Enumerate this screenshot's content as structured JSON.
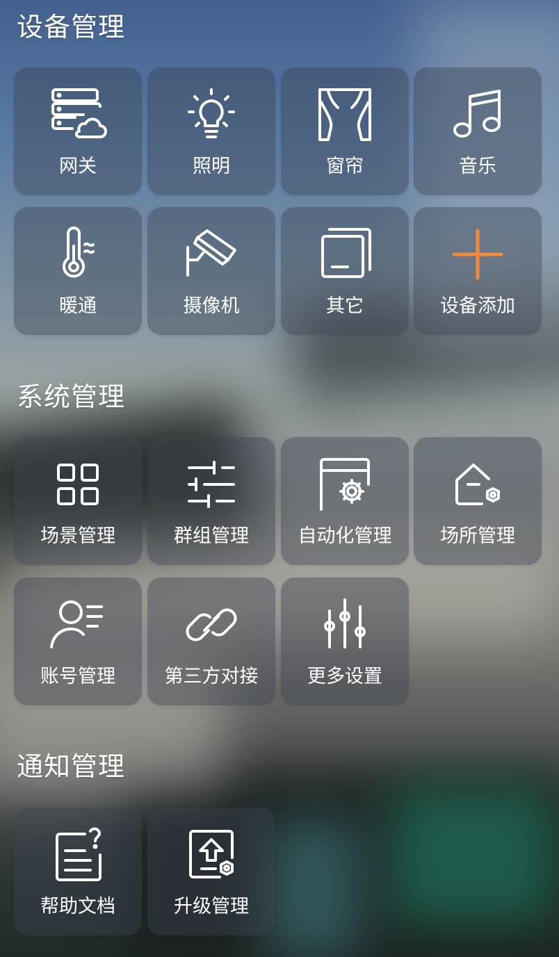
{
  "sections": [
    {
      "title": "设备管理",
      "tiles": [
        {
          "label": "网关",
          "icon": "gateway-cloud-icon"
        },
        {
          "label": "照明",
          "icon": "lightbulb-icon"
        },
        {
          "label": "窗帘",
          "icon": "curtain-icon"
        },
        {
          "label": "音乐",
          "icon": "music-note-icon"
        },
        {
          "label": "暖通",
          "icon": "thermometer-icon"
        },
        {
          "label": "摄像机",
          "icon": "camera-icon"
        },
        {
          "label": "其它",
          "icon": "other-icon"
        },
        {
          "label": "设备添加",
          "icon": "plus-icon"
        }
      ]
    },
    {
      "title": "系统管理",
      "tiles": [
        {
          "label": "场景管理",
          "icon": "scene-grid-icon"
        },
        {
          "label": "群组管理",
          "icon": "group-sliders-icon"
        },
        {
          "label": "自动化管理",
          "icon": "automation-gear-icon"
        },
        {
          "label": "场所管理",
          "icon": "place-house-icon"
        },
        {
          "label": "账号管理",
          "icon": "account-icon"
        },
        {
          "label": "第三方对接",
          "icon": "link-icon"
        },
        {
          "label": "更多设置",
          "icon": "settings-sliders-icon"
        }
      ]
    },
    {
      "title": "通知管理",
      "tiles": [
        {
          "label": "帮助文档",
          "icon": "help-document-icon"
        },
        {
          "label": "升级管理",
          "icon": "upgrade-icon"
        }
      ]
    }
  ],
  "colors": {
    "accent": "#f08a3c",
    "icon_stroke": "#ffffff"
  }
}
